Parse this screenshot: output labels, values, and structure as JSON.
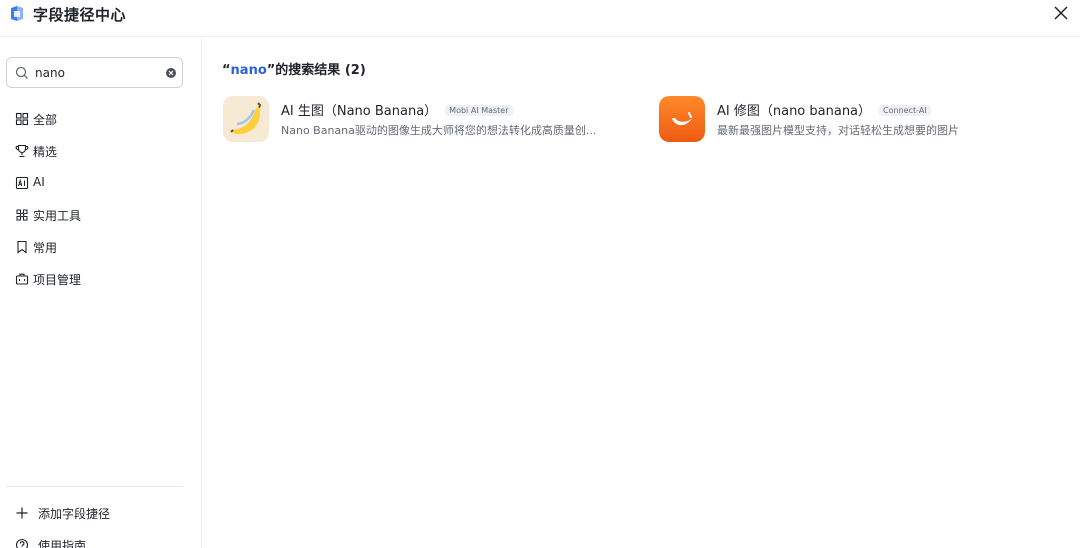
{
  "header": {
    "title": "字段捷径中心",
    "logo_icon": "logo-icon",
    "close_icon": "close-icon"
  },
  "sidebar": {
    "search": {
      "value": "nano",
      "placeholder": "",
      "icon": "search-icon",
      "clear_icon": "clear-icon"
    },
    "items": [
      {
        "id": "all",
        "label": "全部",
        "icon": "grid-icon"
      },
      {
        "id": "featured",
        "label": "精选",
        "icon": "trophy-icon"
      },
      {
        "id": "ai",
        "label": "AI",
        "icon": "ai-icon"
      },
      {
        "id": "tools",
        "label": "实用工具",
        "icon": "tools-icon"
      },
      {
        "id": "common",
        "label": "常用",
        "icon": "bookmark-icon"
      },
      {
        "id": "project",
        "label": "项目管理",
        "icon": "briefcase-icon"
      }
    ],
    "bottom": [
      {
        "id": "add",
        "label": "添加字段捷径",
        "icon": "plus-icon"
      },
      {
        "id": "guide",
        "label": "使用指南",
        "icon": "help-icon"
      }
    ]
  },
  "main": {
    "result_prefix": "“",
    "keyword": "nano",
    "result_suffix": "”的搜索结果 (2)",
    "results": [
      {
        "title": "AI 生图（Nano Banana）",
        "badge": "Mobi AI Master",
        "description": "Nano Banana驱动的图像生成大师将您的想法转化成高质量创...",
        "icon": "banana-icon"
      },
      {
        "title": "AI 修图（nano banana）",
        "badge": "Connect-AI",
        "description": "最新最强图片模型支持，对话轻松生成想要的图片",
        "icon": "banana-orange-icon"
      }
    ]
  },
  "colors": {
    "accent": "#2b62d9",
    "orange": "#f26a1b",
    "text": "#1f2329",
    "muted": "#646a73"
  }
}
